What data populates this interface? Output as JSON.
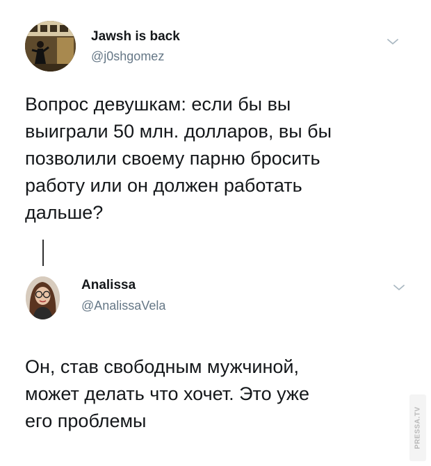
{
  "tweets": [
    {
      "display_name": "Jawsh is back",
      "handle": "@j0shgomez",
      "text": "Вопрос девушкам: если бы вы\nвыиграли 50 млн. долларов, вы бы\nпозволили своему парню бросить\nработу или он должен работать\nдальше?",
      "avatar_icon": "user-avatar-photo",
      "menu_icon": "chevron-down-icon"
    },
    {
      "display_name": "Analissa",
      "handle": "@AnalissaVela",
      "text": "Он, став свободным мужчиной,\nможет делать что хочет. Это уже\nего проблемы",
      "avatar_icon": "user-avatar-photo",
      "menu_icon": "chevron-down-icon"
    }
  ],
  "watermark": "PRESSA.TV",
  "colors": {
    "text": "#14171a",
    "secondary": "#657786",
    "chevron": "#aab8c2",
    "thread_line": "#2f2f2f"
  }
}
